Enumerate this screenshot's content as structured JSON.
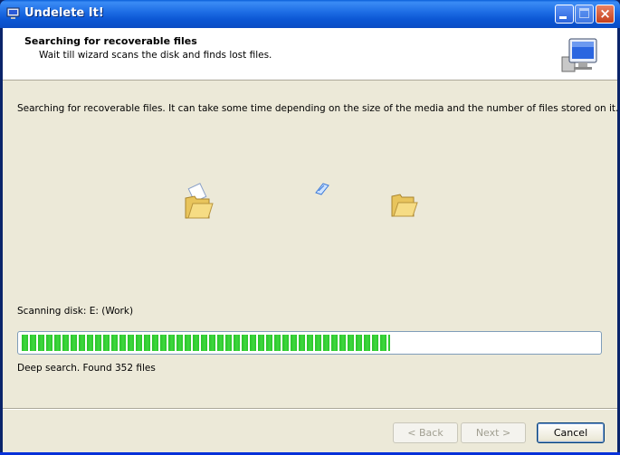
{
  "window": {
    "title": "Undelete It!",
    "controls": {
      "minimize": "minimize",
      "maximize": "maximize",
      "close": "×"
    }
  },
  "header": {
    "title": "Searching for recoverable files",
    "subtitle": "Wait till wizard scans the disk and finds lost files.",
    "icon": "computer-monitor-icon"
  },
  "main": {
    "intro": "Searching for recoverable files. It can take some time depending on the size of the media and the number of files stored on it.",
    "animation": {
      "source_icon": "open-folder-with-document-icon",
      "flying_icon": "flying-paper-icon",
      "target_icon": "open-folder-icon"
    },
    "scan_label": "Scanning disk: E: (Work)",
    "progress_fraction": 0.64,
    "status": "Deep search. Found 352 files"
  },
  "footer": {
    "back_label": "< Back",
    "next_label": "Next >",
    "cancel_label": "Cancel"
  },
  "colors": {
    "titlebar": "#0a56d4",
    "dialog_bg": "#ece9d8",
    "progress_green": "#29c429"
  }
}
